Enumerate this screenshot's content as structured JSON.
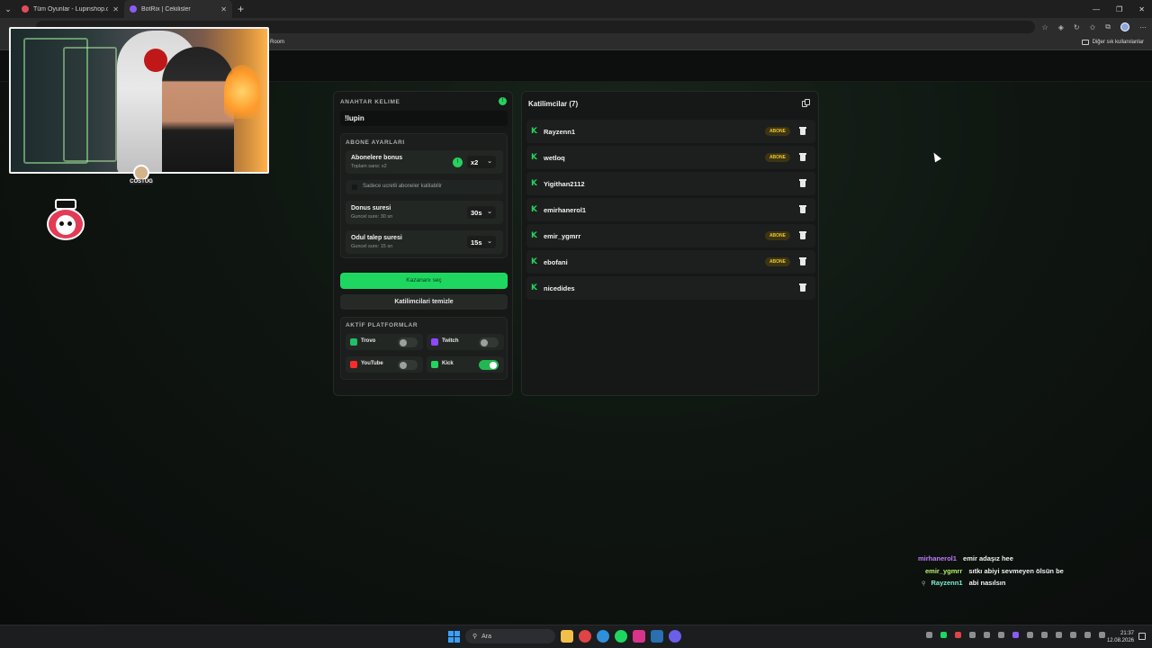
{
  "browser": {
    "tabs": [
      {
        "title": "Tüm Oyunlar - Lupinshop.com",
        "color": "#e34b5b"
      },
      {
        "title": "BotRix | Cekilisler",
        "color": "#8a5cf6"
      }
    ],
    "bookmarks": {
      "room": "Room",
      "other": "Diğer sık kullanılanlar"
    }
  },
  "webcam": {
    "badge_name": "COSTUG"
  },
  "keyword": {
    "heading": "ANAHTAR KELIME",
    "value": "!lupin"
  },
  "subscriber_settings": {
    "heading": "ABONE AYARLARI",
    "bonus": {
      "label": "Abonelere bonus",
      "sub": "Toplam sans: x2",
      "value": "x2"
    },
    "paid_only": "Sadece ucretli aboneler katilabilir",
    "duration": {
      "label": "Donus suresi",
      "sub": "Guncel sure: 30 sn",
      "value": "30s"
    },
    "claim": {
      "label": "Odul talep suresi",
      "sub": "Guncel sure: 15 sn",
      "value": "15s"
    }
  },
  "buttons": {
    "pick_winner": "Kazananı seç",
    "clear": "Katilimcilari temizle"
  },
  "platforms": {
    "heading": "AKTİF PLATFORMLAR",
    "items": [
      {
        "name": "Trovo",
        "on": false,
        "color": "#1fbf6a"
      },
      {
        "name": "Twitch",
        "on": false,
        "color": "#9146ff"
      },
      {
        "name": "YouTube",
        "on": false,
        "color": "#ff2a2a"
      },
      {
        "name": "Kick",
        "on": true,
        "color": "#25d35f"
      }
    ]
  },
  "participants": {
    "title": "Katilimcilar (7)",
    "badge": "ABONE",
    "list": [
      {
        "name": "Rayzenn1",
        "sub": true
      },
      {
        "name": "wetloq",
        "sub": true
      },
      {
        "name": "Yigithan2112",
        "sub": false
      },
      {
        "name": "emirhanerol1",
        "sub": false
      },
      {
        "name": "emir_ygmrr",
        "sub": true
      },
      {
        "name": "ebofani",
        "sub": true
      },
      {
        "name": "nicedides",
        "sub": false
      }
    ]
  },
  "chat": [
    {
      "user": "mirhanerol1",
      "msg": "emir adaşız hee",
      "color": "#c07cff"
    },
    {
      "user": "emir_ygmrr",
      "msg": "sıtkı abiyi sevmeyen ölsün be",
      "color": "#b8f06a"
    },
    {
      "user": "Rayzenn1",
      "msg": "abi nasılsın",
      "color": "#7ff0d0"
    }
  ],
  "taskbar": {
    "search": "Ara",
    "time": "21:37",
    "date": "12.08.2026"
  }
}
